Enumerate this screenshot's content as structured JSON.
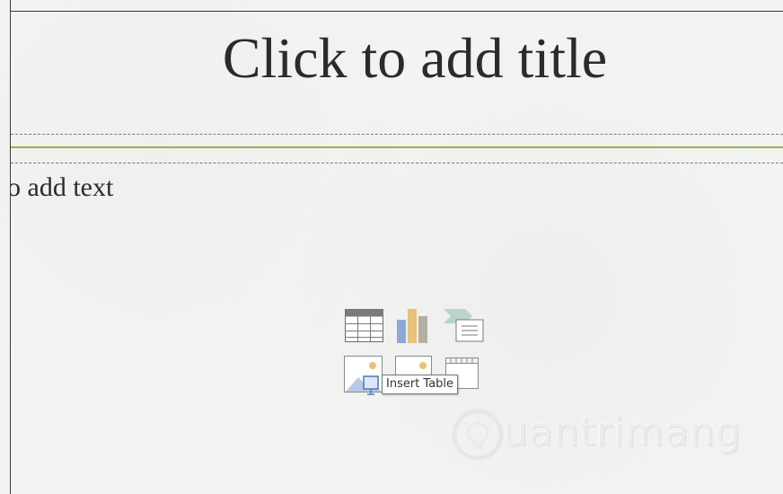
{
  "slide": {
    "title_placeholder": "Click to add title",
    "body_placeholder": "o add text"
  },
  "content_icons": {
    "row1": [
      "table-icon",
      "chart-icon",
      "smartart-icon"
    ],
    "row2": [
      "picture-icon",
      "online-picture-icon",
      "video-icon"
    ],
    "tooltip": "Insert Table"
  },
  "watermark": {
    "text": "uantrimang"
  },
  "colors": {
    "accent_line": "#94b447",
    "slide_bg": "#f3f3f2",
    "title_text": "#2b2b2b"
  }
}
